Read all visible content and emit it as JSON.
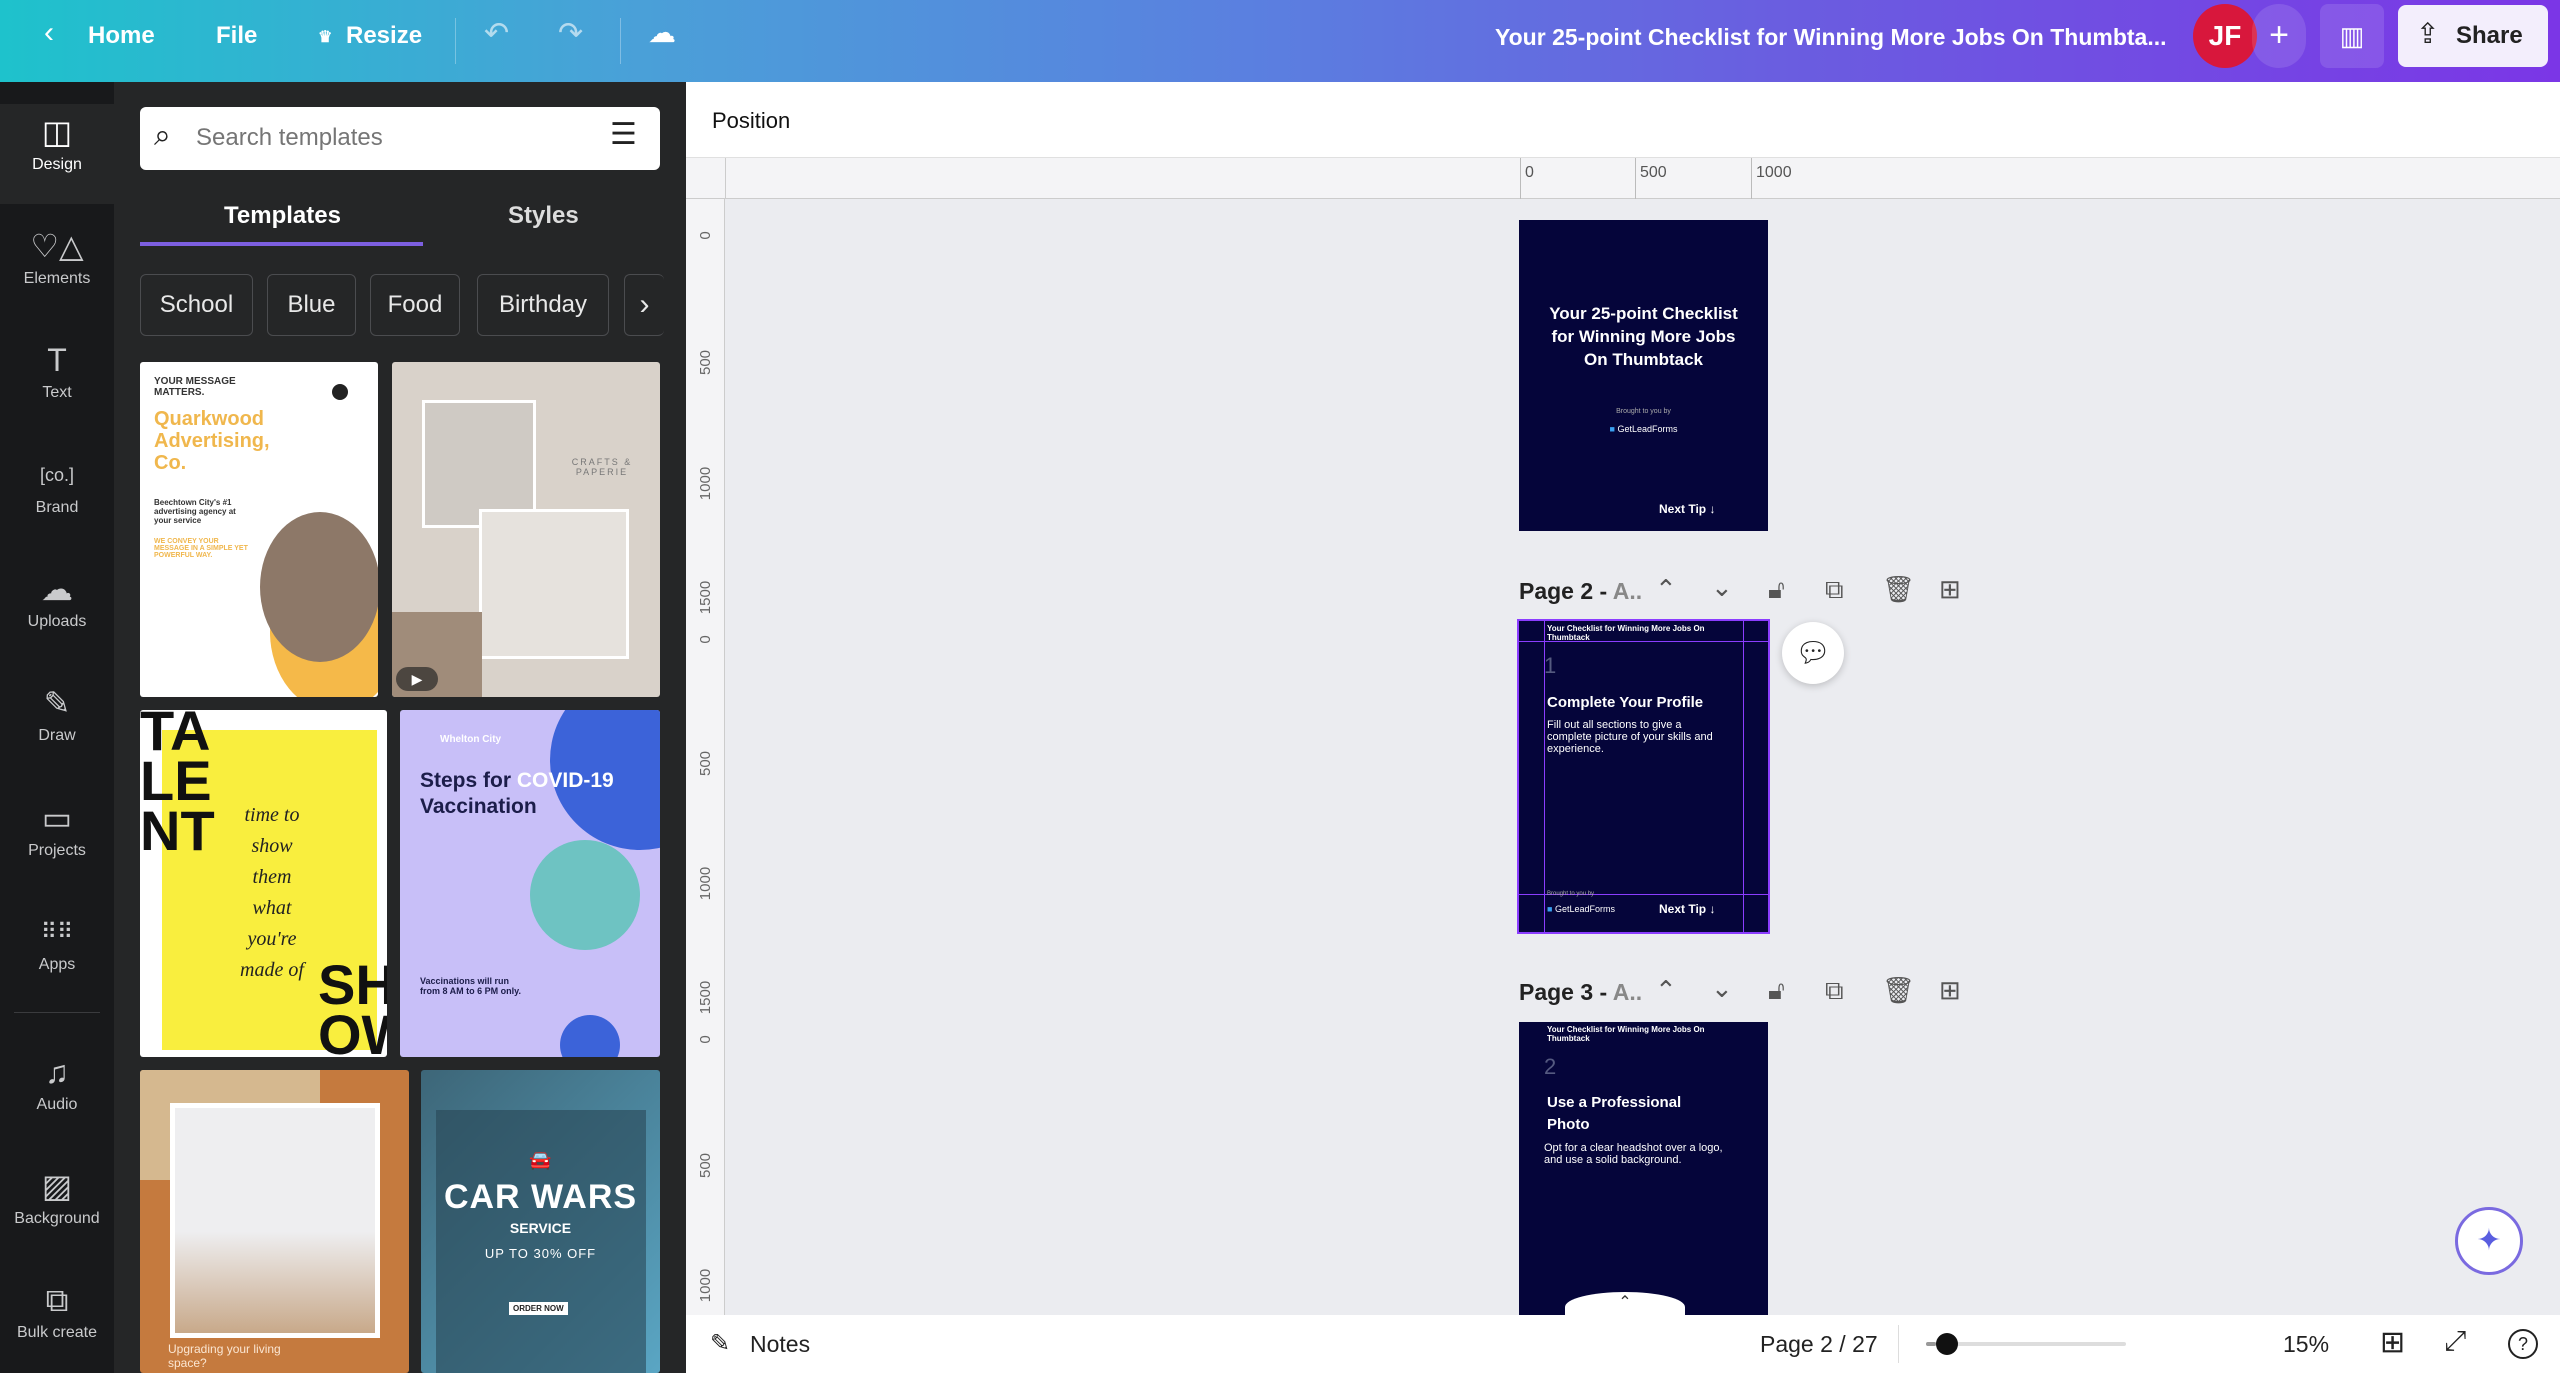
{
  "topbar": {
    "home": "Home",
    "file": "File",
    "resize": "Resize",
    "title": "Your 25-point Checklist for Winning More Jobs On Thumbta...",
    "avatar": "JF",
    "share": "Share"
  },
  "rail": [
    "Design",
    "Elements",
    "Text",
    "Brand",
    "Uploads",
    "Draw",
    "Projects",
    "Apps",
    "Audio",
    "Background",
    "Bulk create"
  ],
  "panel": {
    "search_placeholder": "Search templates",
    "tabs": [
      "Templates",
      "Styles"
    ],
    "chips": [
      "School",
      "Blue",
      "Food",
      "Birthday"
    ],
    "templates": {
      "t1": {
        "kicker": "YOUR MESSAGE MATTERS.",
        "title": "Quarkwood Advertising, Co.",
        "sub": "Beechtown City's #1 advertising agency at your service",
        "tag": "WE CONVEY YOUR MESSAGE IN A SIMPLE YET POWERFUL WAY."
      },
      "t2": {
        "brand": "CRAFTS & PAPERIE"
      },
      "t3": {
        "big1": "TA",
        "big2": "LE",
        "big3": "NT",
        "script": "time to show them what you're made of",
        "big4": "SH",
        "big5": "OW"
      },
      "t4": {
        "org": "Whelton City",
        "title1": "Steps for ",
        "title2": "COVID-19",
        "title3": "Vaccination",
        "note": "Vaccinations will run from 8 AM to 6 PM only."
      },
      "t5": {
        "caption": "Upgrading your living space?"
      },
      "t6": {
        "title": "CAR WARS",
        "sub": "SERVICE",
        "offer": "UP TO 30% OFF",
        "cta": "ORDER NOW"
      }
    }
  },
  "canvas": {
    "position_label": "Position",
    "ruler_h": [
      "0",
      "500",
      "1000"
    ],
    "ruler_v": [
      "0",
      "500",
      "1000",
      "1500",
      "0",
      "500",
      "1000",
      "1500",
      "0",
      "500",
      "1000"
    ],
    "page1": {
      "title": "Your 25-point Checklist for Winning More Jobs On Thumbtack",
      "brought": "Brought to you by",
      "brand": "GetLeadForms",
      "next": "Next Tip ↓"
    },
    "page2": {
      "header": "Page 2 - ",
      "header_sub": "A..",
      "top": "Your Checklist for Winning More Jobs On Thumbtack",
      "num": "1",
      "title": "Complete Your Profile",
      "body": "Fill out all sections to give a complete picture of your skills and experience.",
      "brought": "Brought to you by",
      "brand": "GetLeadForms",
      "next": "Next Tip ↓"
    },
    "page3": {
      "header": "Page 3 - ",
      "header_sub": "A..",
      "top": "Your Checklist for Winning More Jobs On Thumbtack",
      "num": "2",
      "title": "Use a Professional Photo",
      "body": "Opt for a clear headshot over a logo, and use a solid background."
    }
  },
  "bottombar": {
    "notes": "Notes",
    "page": "Page 2 / 27",
    "zoom": "15%",
    "zoom_fraction": 0.05
  }
}
